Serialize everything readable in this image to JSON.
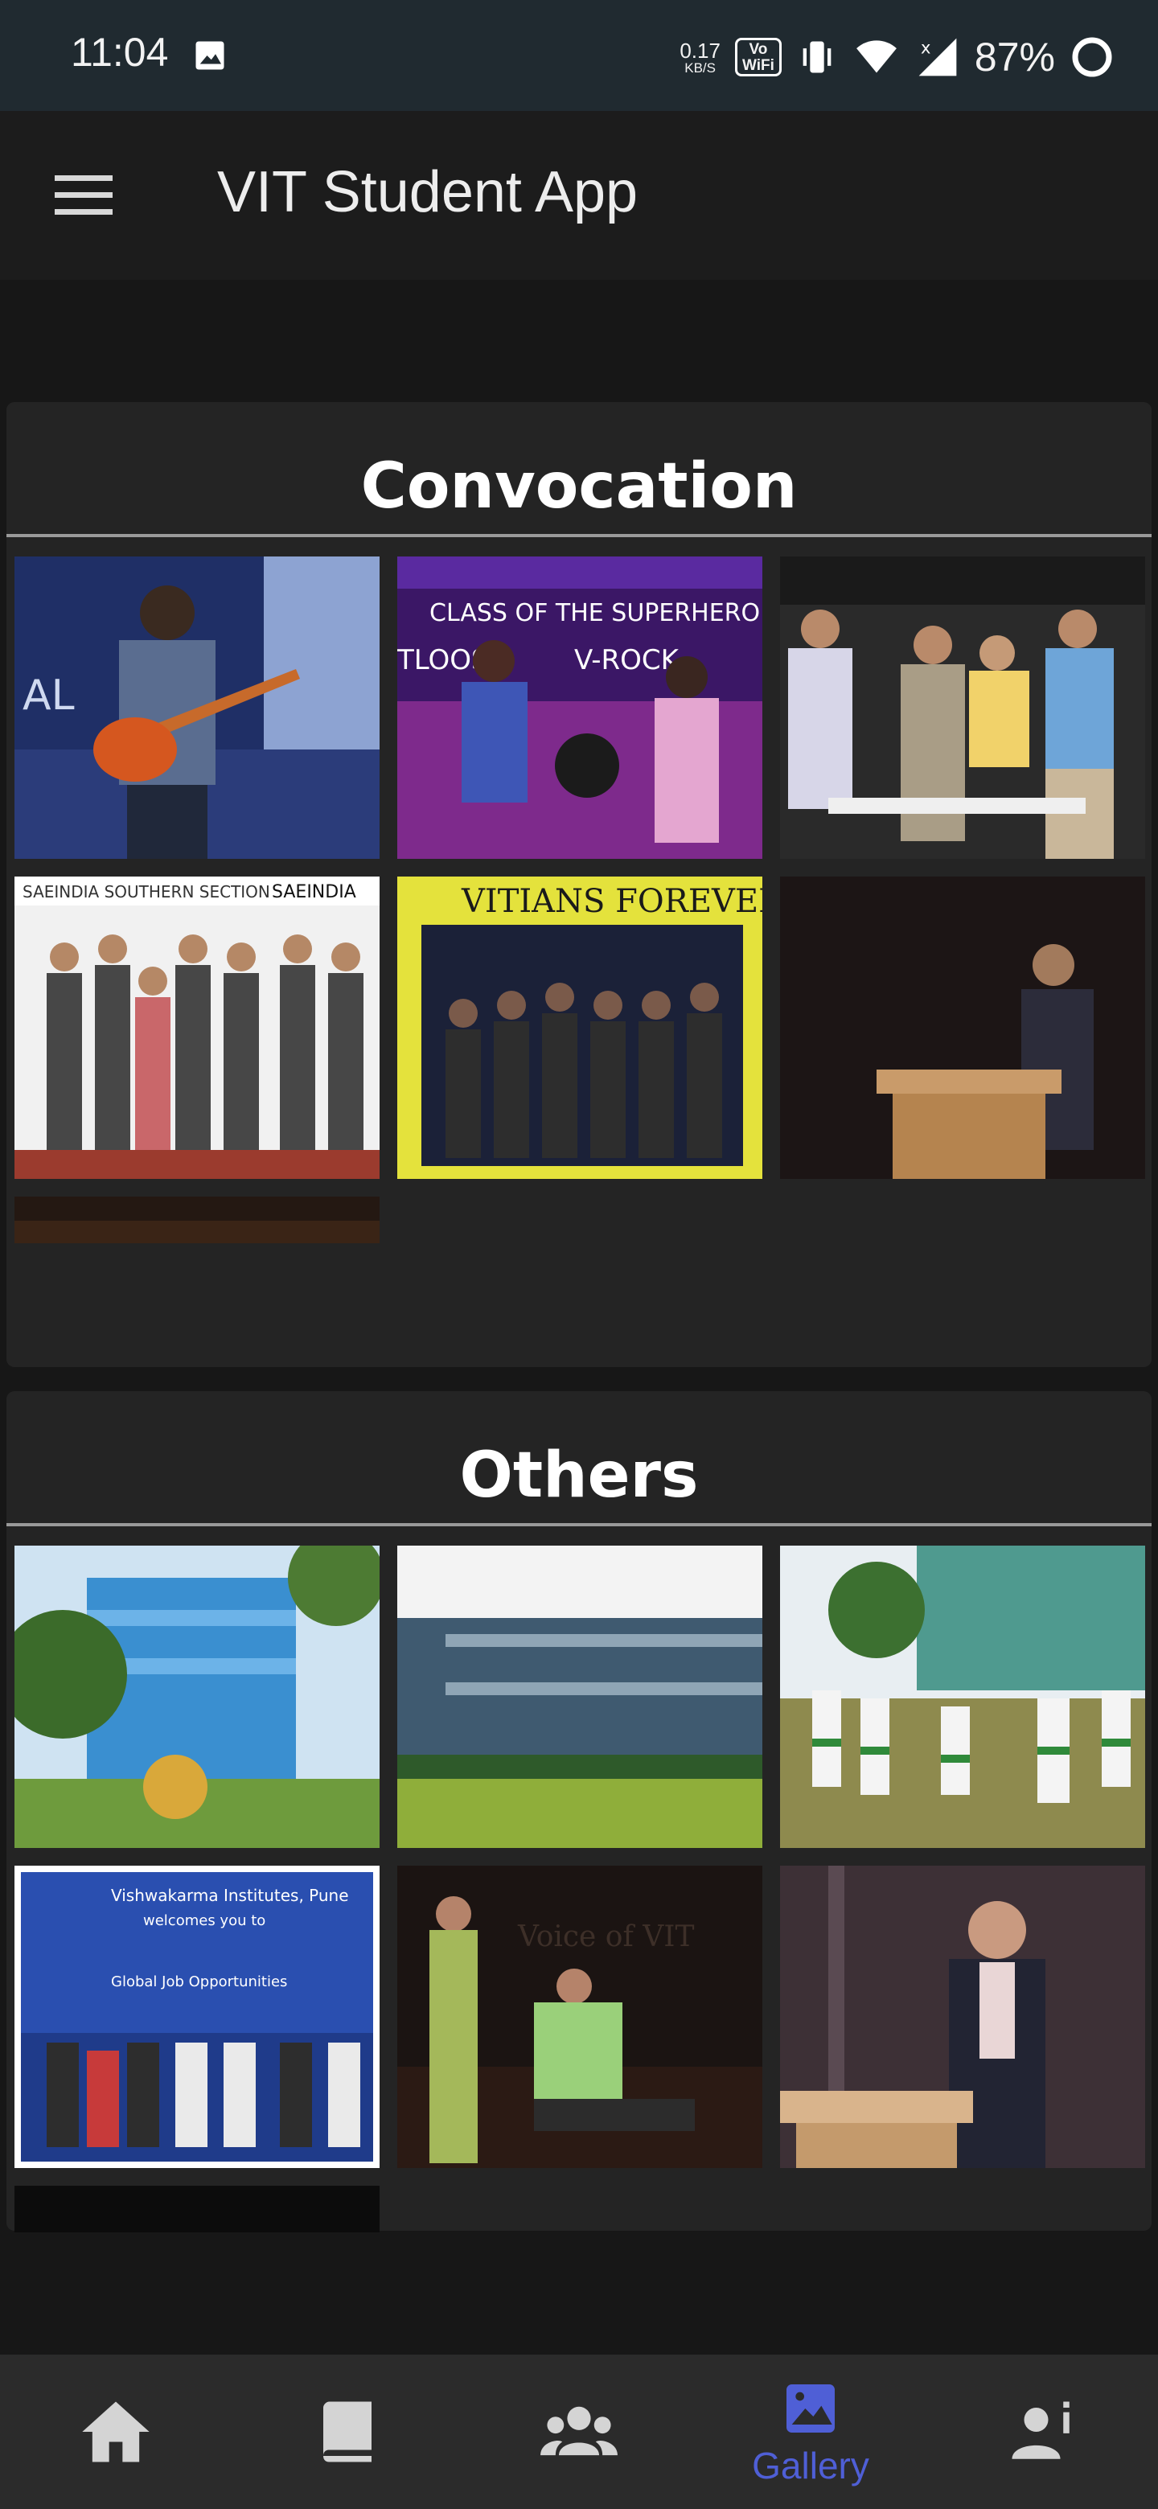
{
  "status_bar": {
    "time": "11:04",
    "net_speed_value": "0.17",
    "net_speed_unit": "KB/S",
    "vowifi_top": "Vo",
    "vowifi_bottom": "WiFi",
    "battery": "87%"
  },
  "app_bar": {
    "title": "VIT Student App"
  },
  "sections": [
    {
      "title": "Convocation",
      "images": [
        {
          "name": "Guitarist on stage"
        },
        {
          "name": "Singers - Class of the Superheroes"
        },
        {
          "name": "Guests at chess board"
        },
        {
          "name": "SAEINDIA group award"
        },
        {
          "name": "Vitians Forever group"
        },
        {
          "name": "Speaker at podium"
        },
        {
          "name": "Dark stage"
        }
      ]
    },
    {
      "title": "Others",
      "images": [
        {
          "name": "Campus building with trees"
        },
        {
          "name": "Campus lawn"
        },
        {
          "name": "Students performing in ground"
        },
        {
          "name": "HR meet group photo"
        },
        {
          "name": "Voice of VIT performance"
        },
        {
          "name": "Speaker at lectern"
        },
        {
          "name": "Dark image"
        }
      ]
    }
  ],
  "bottom_nav": {
    "items": [
      {
        "icon": "home-icon",
        "label": ""
      },
      {
        "icon": "book-icon",
        "label": ""
      },
      {
        "icon": "people-icon",
        "label": ""
      },
      {
        "icon": "gallery-icon",
        "label": "Gallery"
      },
      {
        "icon": "person-info-icon",
        "label": ""
      }
    ],
    "active_color": "#4f5fd6",
    "inactive_color": "#d4d4d4"
  }
}
